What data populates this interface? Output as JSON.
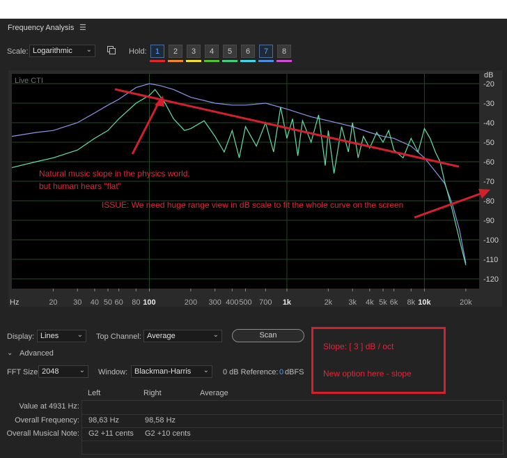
{
  "panel": {
    "title": "Frequency Analysis",
    "menu_icon": "hamburger-menu-icon"
  },
  "controls": {
    "scale_label": "Scale:",
    "scale_value": "Logarithmic",
    "hold_label": "Hold:",
    "hold_buttons": [
      {
        "label": "1",
        "color": "#e0282a",
        "active": true
      },
      {
        "label": "2",
        "color": "#f08a1c",
        "active": false
      },
      {
        "label": "3",
        "color": "#f1e12a",
        "active": false
      },
      {
        "label": "4",
        "color": "#55c22c",
        "active": false
      },
      {
        "label": "5",
        "color": "#3ed07e",
        "active": false
      },
      {
        "label": "6",
        "color": "#3ad8e8",
        "active": false
      },
      {
        "label": "7",
        "color": "#4f8de0",
        "active": true
      },
      {
        "label": "8",
        "color": "#d14ad8",
        "active": false
      }
    ]
  },
  "chart_data": {
    "type": "line",
    "overlay_label": "Live CTI",
    "xlabel": "Hz",
    "ylabel": "dB",
    "x_scale": "log",
    "xlim": [
      10,
      25000
    ],
    "ylim": [
      -125,
      -15
    ],
    "x_ticks": [
      {
        "label": "20",
        "value": 20,
        "major": false
      },
      {
        "label": "30",
        "value": 30,
        "major": false
      },
      {
        "label": "40",
        "value": 40,
        "major": false
      },
      {
        "label": "50",
        "value": 50,
        "major": false
      },
      {
        "label": "60",
        "value": 60,
        "major": false
      },
      {
        "label": "80",
        "value": 80,
        "major": false
      },
      {
        "label": "100",
        "value": 100,
        "major": true
      },
      {
        "label": "200",
        "value": 200,
        "major": false
      },
      {
        "label": "300",
        "value": 300,
        "major": false
      },
      {
        "label": "400",
        "value": 400,
        "major": false
      },
      {
        "label": "500",
        "value": 500,
        "major": false
      },
      {
        "label": "700",
        "value": 700,
        "major": false
      },
      {
        "label": "1k",
        "value": 1000,
        "major": true
      },
      {
        "label": "2k",
        "value": 2000,
        "major": false
      },
      {
        "label": "3k",
        "value": 3000,
        "major": false
      },
      {
        "label": "4k",
        "value": 4000,
        "major": false
      },
      {
        "label": "5k",
        "value": 5000,
        "major": false
      },
      {
        "label": "6k",
        "value": 6000,
        "major": false
      },
      {
        "label": "8k",
        "value": 8000,
        "major": false
      },
      {
        "label": "10k",
        "value": 10000,
        "major": true
      },
      {
        "label": "20k",
        "value": 20000,
        "major": false
      }
    ],
    "y_ticks": [
      {
        "label": "-20",
        "value": -20
      },
      {
        "label": "-30",
        "value": -30
      },
      {
        "label": "-40",
        "value": -40
      },
      {
        "label": "-50",
        "value": -50
      },
      {
        "label": "-60",
        "value": -60
      },
      {
        "label": "-70",
        "value": -70
      },
      {
        "label": "-80",
        "value": -80
      },
      {
        "label": "-90",
        "value": -90
      },
      {
        "label": "-100",
        "value": -100
      },
      {
        "label": "-110",
        "value": -110
      },
      {
        "label": "-120",
        "value": -120
      }
    ],
    "series": [
      {
        "color": "#8f96e8",
        "points": [
          [
            10,
            -47
          ],
          [
            15,
            -45
          ],
          [
            20,
            -44
          ],
          [
            30,
            -40
          ],
          [
            40,
            -35
          ],
          [
            50,
            -31
          ],
          [
            60,
            -28
          ],
          [
            80,
            -22
          ],
          [
            100,
            -20
          ],
          [
            120,
            -21
          ],
          [
            150,
            -23
          ],
          [
            200,
            -27
          ],
          [
            300,
            -30
          ],
          [
            400,
            -31
          ],
          [
            500,
            -31
          ],
          [
            700,
            -30
          ],
          [
            1000,
            -33
          ],
          [
            1500,
            -37
          ],
          [
            2000,
            -39
          ],
          [
            3000,
            -42
          ],
          [
            4000,
            -45
          ],
          [
            5000,
            -47
          ],
          [
            6000,
            -48
          ],
          [
            8000,
            -52
          ],
          [
            10000,
            -58
          ],
          [
            12000,
            -65
          ],
          [
            14000,
            -71
          ],
          [
            16000,
            -82
          ],
          [
            18000,
            -95
          ],
          [
            20000,
            -112
          ]
        ]
      },
      {
        "color": "#5fe3a8",
        "points": [
          [
            10,
            -63
          ],
          [
            15,
            -60
          ],
          [
            20,
            -58
          ],
          [
            30,
            -54
          ],
          [
            40,
            -48
          ],
          [
            50,
            -44
          ],
          [
            60,
            -38
          ],
          [
            80,
            -30
          ],
          [
            100,
            -26
          ],
          [
            110,
            -23
          ],
          [
            130,
            -30
          ],
          [
            150,
            -38
          ],
          [
            180,
            -44
          ],
          [
            200,
            -43
          ],
          [
            250,
            -39
          ],
          [
            300,
            -47
          ],
          [
            350,
            -55
          ],
          [
            400,
            -44
          ],
          [
            450,
            -58
          ],
          [
            500,
            -42
          ],
          [
            600,
            -52
          ],
          [
            700,
            -40
          ],
          [
            800,
            -55
          ],
          [
            900,
            -32
          ],
          [
            1000,
            -48
          ],
          [
            1100,
            -38
          ],
          [
            1200,
            -57
          ],
          [
            1300,
            -39
          ],
          [
            1500,
            -50
          ],
          [
            1700,
            -36
          ],
          [
            1900,
            -62
          ],
          [
            2000,
            -44
          ],
          [
            2200,
            -66
          ],
          [
            2500,
            -42
          ],
          [
            2800,
            -55
          ],
          [
            3000,
            -40
          ],
          [
            3300,
            -58
          ],
          [
            3600,
            -47
          ],
          [
            4000,
            -53
          ],
          [
            4500,
            -45
          ],
          [
            5000,
            -50
          ],
          [
            5500,
            -44
          ],
          [
            6000,
            -54
          ],
          [
            7000,
            -58
          ],
          [
            8000,
            -48
          ],
          [
            9000,
            -55
          ],
          [
            10000,
            -43
          ],
          [
            11000,
            -48
          ],
          [
            12000,
            -55
          ],
          [
            13000,
            -60
          ],
          [
            14000,
            -70
          ],
          [
            16000,
            -85
          ],
          [
            18000,
            -100
          ],
          [
            20000,
            -113
          ]
        ]
      }
    ]
  },
  "annotations": {
    "line1": "Natural music slope in the physics world,",
    "line2": "but human hears \"flat\"",
    "issue": "ISSUE: We need huge range view in dB scale to fit the whole curve on the screen",
    "slope_option": "Slope: [ 3 ] dB / oct",
    "new_option": "New option here - slope"
  },
  "display": {
    "display_label": "Display:",
    "display_value": "Lines",
    "top_channel_label": "Top Channel:",
    "top_channel_value": "Average",
    "scan_label": "Scan",
    "advanced_label": "Advanced",
    "fft_label": "FFT Size:",
    "fft_value": "2048",
    "window_label": "Window:",
    "window_value": "Blackman-Harris",
    "zero_db_label": "0 dB Reference:",
    "zero_db_value": "0",
    "zero_db_unit": "dBFS"
  },
  "table": {
    "headers": [
      "Left",
      "Right",
      "Average"
    ],
    "rows": [
      {
        "label": "Value at 4931 Hz:",
        "left": "",
        "right": "",
        "average": ""
      },
      {
        "label": "Overall Frequency:",
        "left": "98,63 Hz",
        "right": "98,58 Hz",
        "average": ""
      },
      {
        "label": "Overall Musical Note:",
        "left": "G2 +11 cents",
        "right": "G2 +10 cents",
        "average": ""
      }
    ]
  }
}
